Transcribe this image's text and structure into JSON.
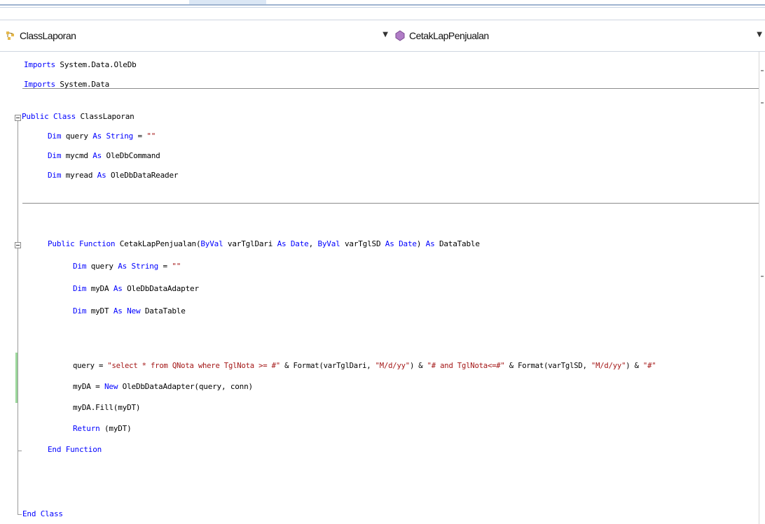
{
  "navbar": {
    "class_dropdown": "ClassLaporan",
    "member_dropdown": "CetakLapPenjualan"
  },
  "code": {
    "l1_kw": "Imports",
    "l1_rest": " System.Data.OleDb",
    "l2_kw": "Imports",
    "l2_rest": " System.Data",
    "l3_kw": "Public Class",
    "l3_rest": " ClassLaporan",
    "l4_kw": "Dim",
    "l4_a": " query ",
    "l4_as": "As",
    "l4_sp": " ",
    "l4_ty": "String",
    "l4_eq": " = ",
    "l4_str": "\"\"",
    "l5_kw": "Dim",
    "l5_a": " mycmd ",
    "l5_as": "As",
    "l5_b": " OleDbCommand",
    "l6_kw": "Dim",
    "l6_a": " myread ",
    "l6_as": "As",
    "l6_b": " OleDbDataReader",
    "l7_kw1": "Public Function",
    "l7_a": " CetakLapPenjualan(",
    "l7_kw2": "ByVal",
    "l7_b": " varTglDari ",
    "l7_as1": "As",
    "l7_sp1": " ",
    "l7_ty1": "Date",
    "l7_c": ", ",
    "l7_kw3": "ByVal",
    "l7_d": " varTglSD ",
    "l7_as2": "As",
    "l7_sp2": " ",
    "l7_ty2": "Date",
    "l7_e": ") ",
    "l7_as3": "As",
    "l7_f": " DataTable",
    "l8_kw": "Dim",
    "l8_a": " query ",
    "l8_as": "As",
    "l8_sp": " ",
    "l8_ty": "String",
    "l8_eq": " = ",
    "l8_str": "\"\"",
    "l9_kw": "Dim",
    "l9_a": " myDA ",
    "l9_as": "As",
    "l9_b": " OleDbDataAdapter",
    "l10_kw": "Dim",
    "l10_a": " myDT ",
    "l10_as": "As",
    "l10_sp": " ",
    "l10_new": "New",
    "l10_b": " DataTable",
    "l11_a": "query = ",
    "l11_s1": "\"select * from QNota where TglNota >= #\"",
    "l11_b": " & Format(varTglDari, ",
    "l11_s2": "\"M/d/yy\"",
    "l11_c": ") & ",
    "l11_s3": "\"# and TglNota<=#\"",
    "l11_d": " & Format(varTglSD, ",
    "l11_s4": "\"M/d/yy\"",
    "l11_e": ") & ",
    "l11_s5": "\"#\"",
    "l12_a": "myDA = ",
    "l12_new": "New",
    "l12_b": " OleDbDataAdapter(query, conn)",
    "l13_a": "myDA.Fill(myDT)",
    "l14_kw": "Return",
    "l14_a": " (myDT)",
    "l15_kw": "End Function",
    "l16_kw": "End Class"
  }
}
